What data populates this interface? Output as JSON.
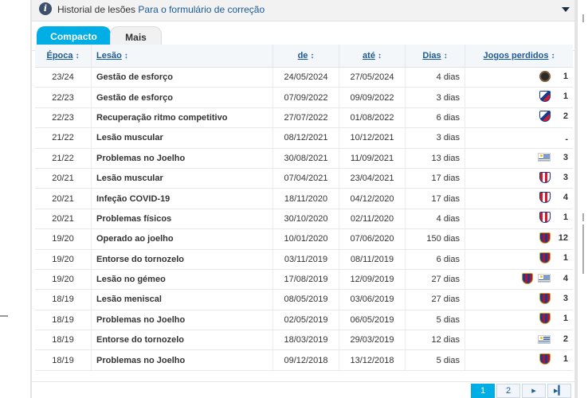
{
  "header": {
    "title": "Historial de lesões",
    "link": "Para o formulário de correção"
  },
  "tabs": [
    {
      "label": "Compacto",
      "active": true
    },
    {
      "label": "Mais",
      "active": false
    }
  ],
  "columns": {
    "season": "Época",
    "injury": "Lesão",
    "from": "de",
    "until": "até",
    "days": "Dias",
    "games": "Jogos perdidos"
  },
  "rows": [
    {
      "season": "23/24",
      "injury": "Gestão de esforço",
      "from": "24/05/2024",
      "until": "27/05/2024",
      "days": "4 dias",
      "games": "1",
      "crests": [
        "miami"
      ]
    },
    {
      "season": "22/23",
      "injury": "Gestão de esforço",
      "from": "07/09/2022",
      "until": "09/09/2022",
      "days": "3 dias",
      "games": "1",
      "crests": [
        "nacional"
      ]
    },
    {
      "season": "22/23",
      "injury": "Recuperação ritmo competitivo",
      "from": "27/07/2022",
      "until": "01/08/2022",
      "days": "6 dias",
      "games": "2",
      "crests": [
        "nacional"
      ]
    },
    {
      "season": "21/22",
      "injury": "Lesão muscular",
      "from": "08/12/2021",
      "until": "10/12/2021",
      "days": "3 dias",
      "games": "-",
      "crests": []
    },
    {
      "season": "21/22",
      "injury": "Problemas no Joelho",
      "from": "30/08/2021",
      "until": "11/09/2021",
      "days": "13 dias",
      "games": "3",
      "crests": [
        "uruguay"
      ]
    },
    {
      "season": "20/21",
      "injury": "Lesão muscular",
      "from": "07/04/2021",
      "until": "23/04/2021",
      "days": "17 dias",
      "games": "3",
      "crests": [
        "atletico"
      ]
    },
    {
      "season": "20/21",
      "injury": "Infeção COVID-19",
      "from": "18/11/2020",
      "until": "04/12/2020",
      "days": "17 dias",
      "games": "4",
      "crests": [
        "atletico"
      ]
    },
    {
      "season": "20/21",
      "injury": "Problemas físicos",
      "from": "30/10/2020",
      "until": "02/11/2020",
      "days": "4 dias",
      "games": "1",
      "crests": [
        "atletico"
      ]
    },
    {
      "season": "19/20",
      "injury": "Operado ao joelho",
      "from": "10/01/2020",
      "until": "07/06/2020",
      "days": "150 dias",
      "games": "12",
      "crests": [
        "barcelona"
      ]
    },
    {
      "season": "19/20",
      "injury": "Entorse do tornozelo",
      "from": "03/11/2019",
      "until": "08/11/2019",
      "days": "6 dias",
      "games": "1",
      "crests": [
        "barcelona"
      ]
    },
    {
      "season": "19/20",
      "injury": "Lesão no gémeo",
      "from": "17/08/2019",
      "until": "12/09/2019",
      "days": "27 dias",
      "games": "4",
      "crests": [
        "barcelona",
        "uruguay"
      ]
    },
    {
      "season": "18/19",
      "injury": "Lesão meniscal",
      "from": "08/05/2019",
      "until": "03/06/2019",
      "days": "27 dias",
      "games": "3",
      "crests": [
        "barcelona"
      ]
    },
    {
      "season": "18/19",
      "injury": "Problemas no Joelho",
      "from": "02/05/2019",
      "until": "06/05/2019",
      "days": "5 dias",
      "games": "1",
      "crests": [
        "barcelona"
      ]
    },
    {
      "season": "18/19",
      "injury": "Entorse do tornozelo",
      "from": "18/03/2019",
      "until": "29/03/2019",
      "days": "12 dias",
      "games": "2",
      "crests": [
        "uruguay"
      ]
    },
    {
      "season": "18/19",
      "injury": "Problemas no Joelho",
      "from": "09/12/2018",
      "until": "13/12/2018",
      "days": "5 dias",
      "games": "1",
      "crests": [
        "barcelona"
      ]
    }
  ],
  "pagination": {
    "pages": [
      "1",
      "2"
    ],
    "current": "1",
    "next": "▸",
    "last": "▸▎"
  },
  "icons": {
    "info": "i",
    "sort": "↕",
    "collapse": "caret-down-icon"
  },
  "colors": {
    "accent": "#00aee6",
    "link": "#1a5a96"
  }
}
